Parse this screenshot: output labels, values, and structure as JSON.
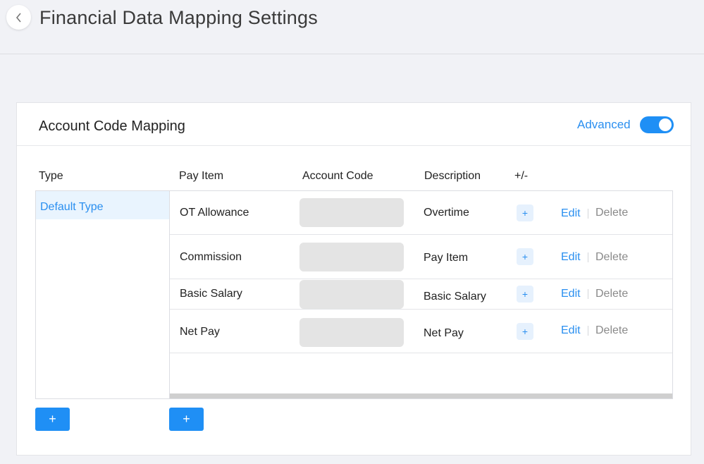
{
  "page": {
    "title": "Financial Data Mapping Settings"
  },
  "card": {
    "title": "Account Code Mapping",
    "advanced_label": "Advanced",
    "advanced_enabled": true
  },
  "columns": {
    "type": "Type",
    "pay_item": "Pay Item",
    "account_code": "Account Code",
    "description": "Description",
    "plus_minus": "+/-"
  },
  "types": [
    {
      "label": "Default Type",
      "selected": true
    }
  ],
  "rows": [
    {
      "pay_item": "OT Allowance",
      "account_code": "",
      "description": "Overtime",
      "add": "+",
      "edit": "Edit",
      "delete": "Delete"
    },
    {
      "pay_item": "Commission",
      "account_code": "",
      "description": "Pay Item",
      "add": "+",
      "edit": "Edit",
      "delete": "Delete"
    },
    {
      "pay_item": "Basic Salary",
      "account_code": "",
      "description": "Basic Salary",
      "add": "+",
      "edit": "Edit",
      "delete": "Delete"
    },
    {
      "pay_item": "Net Pay",
      "account_code": "",
      "description": "Net Pay",
      "add": "+",
      "edit": "Edit",
      "delete": "Delete"
    }
  ],
  "buttons": {
    "add_type": "+",
    "add_pay_item": "+"
  },
  "icons": {
    "back": "chevron-left-icon"
  },
  "colors": {
    "accent": "#1f8ff5",
    "link": "#2a8ff0",
    "muted": "#8a8a8a"
  }
}
